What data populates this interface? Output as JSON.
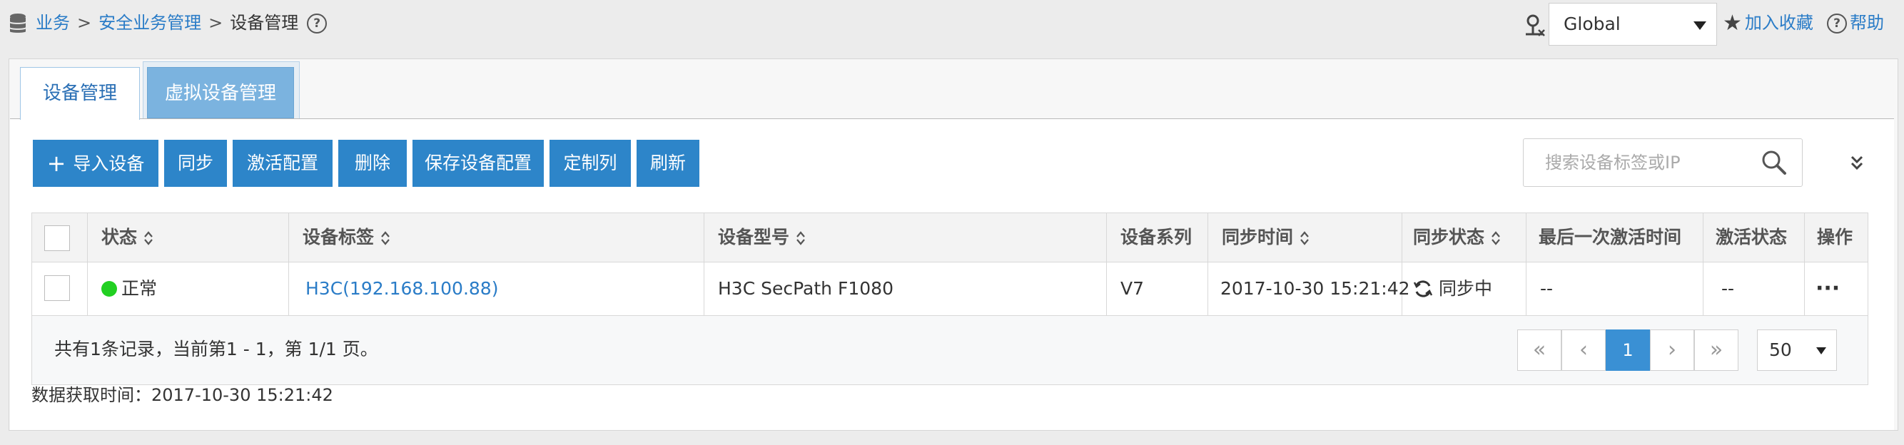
{
  "breadcrumb": {
    "item1": "业务",
    "item2": "安全业务管理",
    "current": "设备管理",
    "separator": ">"
  },
  "help_glyph": "?",
  "header": {
    "region_value": "Global",
    "favorite_label": "加入收藏",
    "help_label": "帮助"
  },
  "tabs": [
    {
      "label": "设备管理"
    },
    {
      "label": "虚拟设备管理"
    }
  ],
  "toolbar": {
    "import_plus": "+",
    "import": "导入设备",
    "sync": "同步",
    "activate": "激活配置",
    "delete": "删除",
    "save_config": "保存设备配置",
    "custom_columns": "定制列",
    "refresh": "刷新"
  },
  "search": {
    "placeholder": "搜索设备标签或IP"
  },
  "table": {
    "headers": {
      "status": "状态",
      "label": "设备标签",
      "model": "设备型号",
      "series": "设备系列",
      "sync_time": "同步时间",
      "sync_status": "同步状态",
      "last_activation": "最后一次激活时间",
      "activation_status": "激活状态",
      "actions": "操作"
    },
    "rows": [
      {
        "status": "正常",
        "label": "H3C(192.168.100.88)",
        "model": "H3C SecPath F1080",
        "series": "V7",
        "sync_time": "2017-10-30 15:21:42",
        "sync_status": "同步中",
        "last_activation": "--",
        "activation_status": "--",
        "actions": "···"
      }
    ]
  },
  "pagination": {
    "summary": "共有1条记录，当前第1 - 1，第 1/1 页。",
    "first": "«",
    "prev": "‹",
    "current_page": "1",
    "next": "›",
    "last": "»",
    "page_size": "50"
  },
  "fetch_time": "数据获取时间：2017-10-30 15:21:42",
  "colors": {
    "accent": "#2d85c9",
    "link": "#2a7cc7",
    "status_ok": "#22d022"
  }
}
